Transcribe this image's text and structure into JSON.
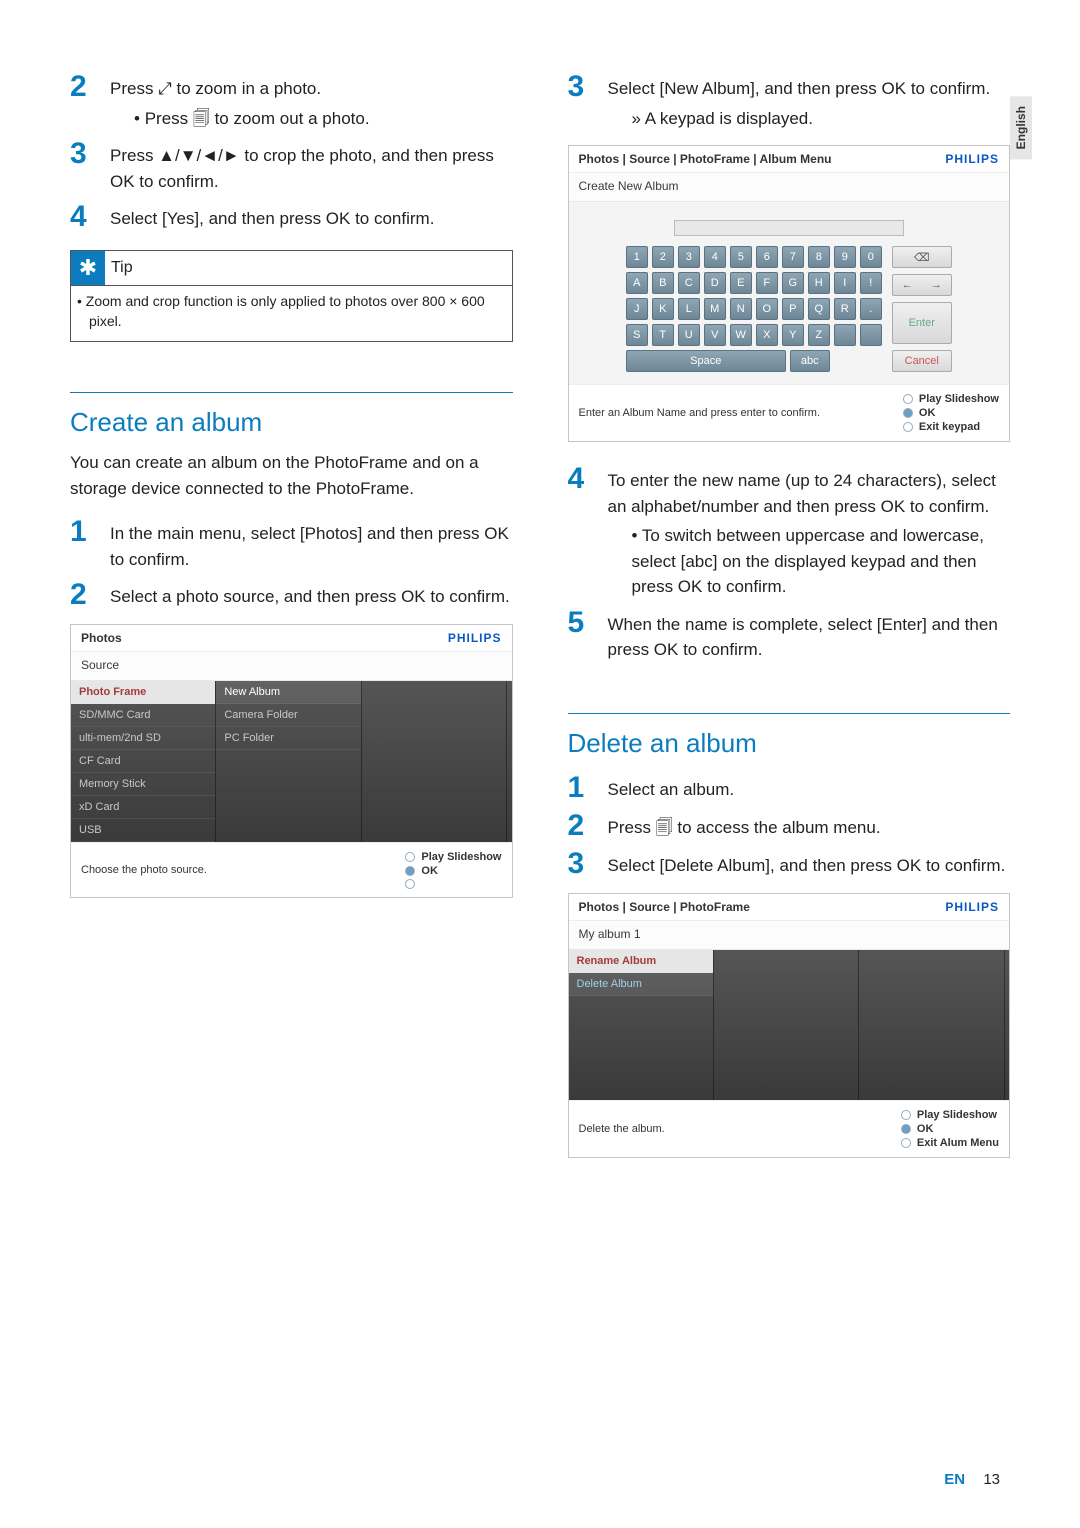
{
  "lang_tab": "English",
  "left": {
    "steps_a": [
      {
        "n": "2",
        "body": "Press ⤢ to zoom in a photo.",
        "sub_bullet": "Press 🗐 to zoom out a photo."
      },
      {
        "n": "3",
        "body": "Press ▲/▼/◄/► to crop the photo, and then press OK to confirm."
      },
      {
        "n": "4",
        "body": "Select [Yes], and then press OK to confirm."
      }
    ],
    "tip_label": "Tip",
    "tip_body": "Zoom and crop function is only applied to photos over 800 × 600 pixel.",
    "heading": "Create an album",
    "intro": "You can create an album on the PhotoFrame and on a storage device connected to the PhotoFrame.",
    "steps_b": [
      {
        "n": "1",
        "body": "In the main menu, select [Photos] and then press OK to confirm."
      },
      {
        "n": "2",
        "body": "Select a photo source, and then press OK to confirm."
      }
    ],
    "shot1": {
      "breadcrumb": "Photos",
      "brand": "PHILIPS",
      "sub": "Source",
      "col1": [
        "Photo Frame",
        "SD/MMC Card",
        "ulti-mem/2nd SD",
        "CF Card",
        "Memory Stick",
        "xD Card",
        "USB"
      ],
      "col2": [
        "New Album",
        "Camera Folder",
        "PC Folder"
      ],
      "foot_left": "Choose the photo source.",
      "foot_ctrl": [
        "Play Slideshow",
        "OK"
      ]
    }
  },
  "right": {
    "steps_a": [
      {
        "n": "3",
        "body": "Select [New Album], and then press OK to confirm.",
        "sub_arrow": "A keypad is displayed."
      }
    ],
    "shot2": {
      "breadcrumb": "Photos | Source | PhotoFrame | Album Menu",
      "brand": "PHILIPS",
      "sub": "Create New Album",
      "rows": [
        [
          "1",
          "2",
          "3",
          "4",
          "5",
          "6",
          "7",
          "8",
          "9",
          "0"
        ],
        [
          "A",
          "B",
          "C",
          "D",
          "E",
          "F",
          "G",
          "H",
          "I",
          "!"
        ],
        [
          "J",
          "K",
          "L",
          "M",
          "N",
          "O",
          "P",
          "Q",
          "R",
          "."
        ],
        [
          "S",
          "T",
          "U",
          "V",
          "W",
          "X",
          "Y",
          "Z",
          " ",
          " "
        ]
      ],
      "space": "Space",
      "abc": "abc",
      "bksp": "⌫",
      "arrows": [
        "←",
        "→"
      ],
      "enter": "Enter",
      "cancel": "Cancel",
      "foot_left": "Enter an Album Name and press enter to confirm.",
      "foot_ctrl": [
        "Play Slideshow",
        "OK",
        "Exit keypad"
      ]
    },
    "steps_b": [
      {
        "n": "4",
        "body": "To enter the new name (up to 24 characters), select an alphabet/number and then press OK to confirm.",
        "sub_bullet": "To switch between uppercase and lowercase, select [abc] on the displayed keypad and then press OK to confirm."
      },
      {
        "n": "5",
        "body": "When the name is complete, select [Enter] and then press OK to confirm."
      }
    ],
    "heading2": "Delete an album",
    "steps_c": [
      {
        "n": "1",
        "body": "Select an album."
      },
      {
        "n": "2",
        "body": "Press 🗐 to access the album menu."
      },
      {
        "n": "3",
        "body": "Select [Delete Album], and then press OK to confirm."
      }
    ],
    "shot3": {
      "breadcrumb": "Photos | Source | PhotoFrame",
      "brand": "PHILIPS",
      "sub": "My album 1",
      "col1": [
        "Rename Album",
        "Delete Album"
      ],
      "foot_left": "Delete the album.",
      "foot_ctrl": [
        "Play Slideshow",
        "OK",
        "Exit Alum Menu"
      ]
    }
  },
  "footer": {
    "lang": "EN",
    "page": "13"
  }
}
